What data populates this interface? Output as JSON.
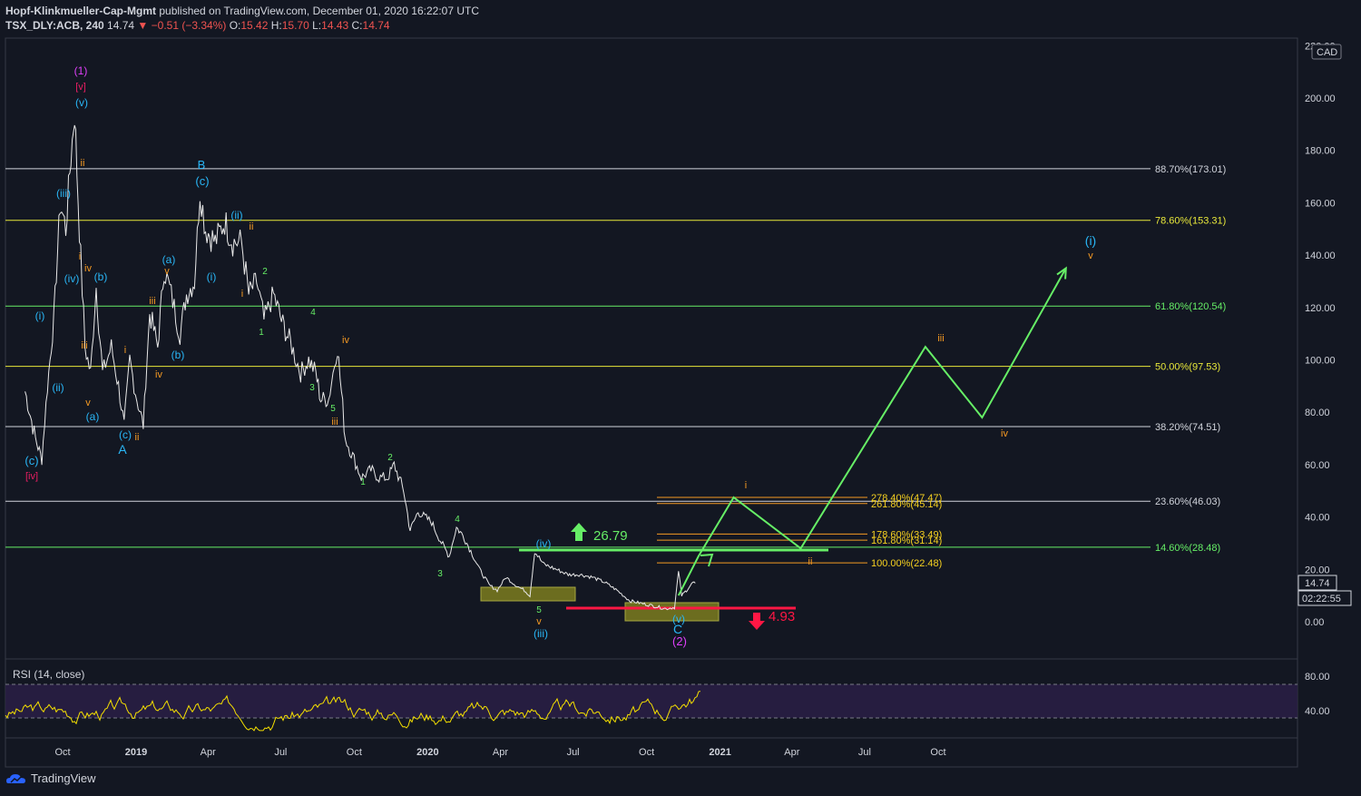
{
  "header": {
    "author": "Hopf-Klinkmueller-Cap-Mgmt",
    "published": "published on TradingView.com, December 01, 2020 16:22:07 UTC",
    "symbol": "TSX_DLY:ACB, 240",
    "last": "14.74",
    "change": "▼ −0.51 (−3.34%)",
    "o_label": "O:",
    "o_value": "15.42",
    "h_label": "H:",
    "h_value": "15.70",
    "l_label": "L:",
    "l_value": "14.43",
    "c_label": "C:",
    "c_value": "14.74"
  },
  "currency": "CAD",
  "price_axis": [
    "220.00",
    "200.00",
    "180.00",
    "160.00",
    "140.00",
    "120.00",
    "100.00",
    "80.00",
    "60.00",
    "40.00",
    "20.00",
    "0.00"
  ],
  "price_badge": "14.74",
  "countdown": "02:22:55",
  "time_axis": [
    "Oct",
    "2019",
    "Apr",
    "Jul",
    "Oct",
    "2020",
    "Apr",
    "Jul",
    "Oct",
    "2021",
    "Apr",
    "Jul",
    "Oct"
  ],
  "rsi": {
    "label": "RSI (14, close)",
    "axis": [
      "80.00",
      "40.00"
    ]
  },
  "logo": "TradingView",
  "colors": {
    "bg": "#131722",
    "green": "#66ee66",
    "yellow": "#e8e83a",
    "orange": "#f59a23",
    "cyan": "#29b6f6",
    "magenta": "#e040fb",
    "red": "#ff1744",
    "rsi": "#f5e000"
  },
  "chart_data": {
    "type": "line",
    "title": "TSX_DLY:ACB, 240",
    "xlabel": "",
    "ylabel": "",
    "ylim": [
      -10,
      220
    ],
    "levels": [
      {
        "label": "88.70%(173.01)",
        "value": 173.01,
        "color": "#d1d4dc"
      },
      {
        "label": "78.60%(153.31)",
        "value": 153.31,
        "color": "#e8e83a"
      },
      {
        "label": "61.80%(120.54)",
        "value": 120.54,
        "color": "#66ee66"
      },
      {
        "label": "50.00%(97.53)",
        "value": 97.53,
        "color": "#e8e83a"
      },
      {
        "label": "38.20%(74.51)",
        "value": 74.51,
        "color": "#d1d4dc"
      },
      {
        "label": "23.60%(46.03)",
        "value": 46.03,
        "color": "#d1d4dc"
      },
      {
        "label": "14.60%(28.48)",
        "value": 28.48,
        "color": "#66ee66"
      }
    ],
    "ext_levels": [
      {
        "label": "278.40%(47.47)",
        "value": 47.47
      },
      {
        "label": "261.80%(45.14)",
        "value": 45.14
      },
      {
        "label": "178.60%(33.49)",
        "value": 33.49
      },
      {
        "label": "161.80%(31.14)",
        "value": 31.14
      },
      {
        "label": "100.00%(22.48)",
        "value": 22.48
      }
    ],
    "price_series": [
      [
        "2018-08-15",
        88
      ],
      [
        "2018-08-28",
        70
      ],
      [
        "2018-09-05",
        62
      ],
      [
        "2018-09-12",
        90
      ],
      [
        "2018-09-20",
        115
      ],
      [
        "2018-09-28",
        160
      ],
      [
        "2018-10-05",
        150
      ],
      [
        "2018-10-10",
        172
      ],
      [
        "2018-10-16",
        195
      ],
      [
        "2018-10-22",
        150
      ],
      [
        "2018-10-29",
        105
      ],
      [
        "2018-11-05",
        95
      ],
      [
        "2018-11-12",
        128
      ],
      [
        "2018-11-20",
        95
      ],
      [
        "2018-12-01",
        105
      ],
      [
        "2018-12-10",
        90
      ],
      [
        "2018-12-17",
        75
      ],
      [
        "2018-12-24",
        100
      ],
      [
        "2019-01-02",
        85
      ],
      [
        "2019-01-10",
        75
      ],
      [
        "2019-01-18",
        118
      ],
      [
        "2019-01-28",
        105
      ],
      [
        "2019-02-05",
        135
      ],
      [
        "2019-02-14",
        125
      ],
      [
        "2019-02-25",
        110
      ],
      [
        "2019-03-05",
        125
      ],
      [
        "2019-03-15",
        130
      ],
      [
        "2019-03-22",
        165
      ],
      [
        "2019-03-29",
        150
      ],
      [
        "2019-04-10",
        145
      ],
      [
        "2019-04-22",
        153
      ],
      [
        "2019-05-02",
        145
      ],
      [
        "2019-05-13",
        145
      ],
      [
        "2019-05-22",
        125
      ],
      [
        "2019-06-01",
        130
      ],
      [
        "2019-06-10",
        115
      ],
      [
        "2019-06-22",
        125
      ],
      [
        "2019-07-02",
        115
      ],
      [
        "2019-07-15",
        105
      ],
      [
        "2019-07-26",
        95
      ],
      [
        "2019-08-05",
        100
      ],
      [
        "2019-08-14",
        95
      ],
      [
        "2019-08-20",
        85
      ],
      [
        "2019-08-30",
        85
      ],
      [
        "2019-09-10",
        105
      ],
      [
        "2019-09-20",
        70
      ],
      [
        "2019-10-01",
        62
      ],
      [
        "2019-10-10",
        55
      ],
      [
        "2019-10-22",
        58
      ],
      [
        "2019-11-01",
        55
      ],
      [
        "2019-11-12",
        55
      ],
      [
        "2019-11-20",
        60
      ],
      [
        "2019-12-02",
        50
      ],
      [
        "2019-12-10",
        35
      ],
      [
        "2019-12-20",
        42
      ],
      [
        "2020-01-06",
        38
      ],
      [
        "2020-01-15",
        32
      ],
      [
        "2020-01-28",
        25
      ],
      [
        "2020-02-06",
        36
      ],
      [
        "2020-02-14",
        33
      ],
      [
        "2020-02-24",
        27
      ],
      [
        "2020-03-06",
        20
      ],
      [
        "2020-03-18",
        14
      ],
      [
        "2020-03-28",
        12
      ],
      [
        "2020-04-08",
        17
      ],
      [
        "2020-04-20",
        14
      ],
      [
        "2020-05-01",
        12
      ],
      [
        "2020-05-08",
        10
      ],
      [
        "2020-05-14",
        26.8
      ],
      [
        "2020-05-25",
        22
      ],
      [
        "2020-06-10",
        20
      ],
      [
        "2020-06-25",
        18
      ],
      [
        "2020-07-10",
        18
      ],
      [
        "2020-07-25",
        17
      ],
      [
        "2020-08-10",
        15
      ],
      [
        "2020-08-25",
        12
      ],
      [
        "2020-09-10",
        8
      ],
      [
        "2020-09-25",
        7
      ],
      [
        "2020-10-10",
        6
      ],
      [
        "2020-10-25",
        5
      ],
      [
        "2020-11-05",
        5.5
      ],
      [
        "2020-11-10",
        19
      ],
      [
        "2020-11-14",
        10
      ],
      [
        "2020-11-20",
        12
      ],
      [
        "2020-11-28",
        15
      ],
      [
        "2020-12-01",
        14.74
      ]
    ],
    "projection": [
      [
        "2020-11-10",
        10
      ],
      [
        "2020-12-05",
        25
      ],
      [
        "2021-01-18",
        47.5
      ],
      [
        "2021-04-12",
        28
      ],
      [
        "2021-09-15",
        105
      ],
      [
        "2021-11-25",
        78
      ],
      [
        "2022-03-10",
        135
      ]
    ],
    "annotations": {
      "projection_top": {
        "label": "(i)",
        "sub": "v"
      },
      "up_target": "26.79",
      "down_target": "4.93"
    }
  }
}
